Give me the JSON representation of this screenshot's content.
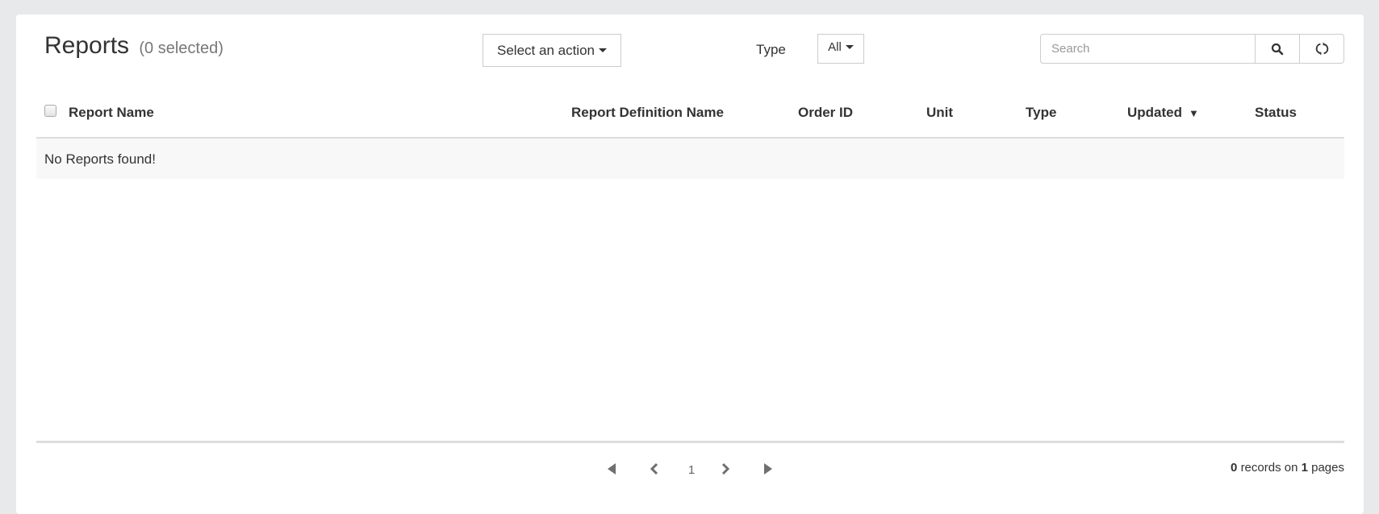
{
  "header": {
    "title": "Reports",
    "selection_count": "(0 selected)"
  },
  "toolbar": {
    "action_label": "Select an action",
    "type_label": "Type",
    "type_value": "All",
    "search_placeholder": "Search",
    "search_value": "",
    "search_icon": "search-icon",
    "refresh_icon": "refresh-icon"
  },
  "table": {
    "columns": [
      {
        "label": "Report Name"
      },
      {
        "label": "Report Definition Name"
      },
      {
        "label": "Order ID"
      },
      {
        "label": "Unit"
      },
      {
        "label": "Type"
      },
      {
        "label": "Updated",
        "sort": "descending"
      },
      {
        "label": "Status"
      }
    ],
    "rows": [],
    "empty_message": "No Reports found!"
  },
  "pagination": {
    "current_page": "1",
    "records_count": "0",
    "records_text": "records on",
    "pages_count": "1",
    "pages_text": "pages",
    "first_icon": "first-page-icon",
    "prev_icon": "prev-page-icon",
    "next_icon": "next-page-icon",
    "last_icon": "last-page-icon"
  },
  "colors": {
    "background": "#e8e9ea",
    "card": "#ffffff",
    "border": "#cccccc",
    "text": "#333333",
    "muted": "#777777",
    "pager_icon": "#6f6f6f"
  }
}
